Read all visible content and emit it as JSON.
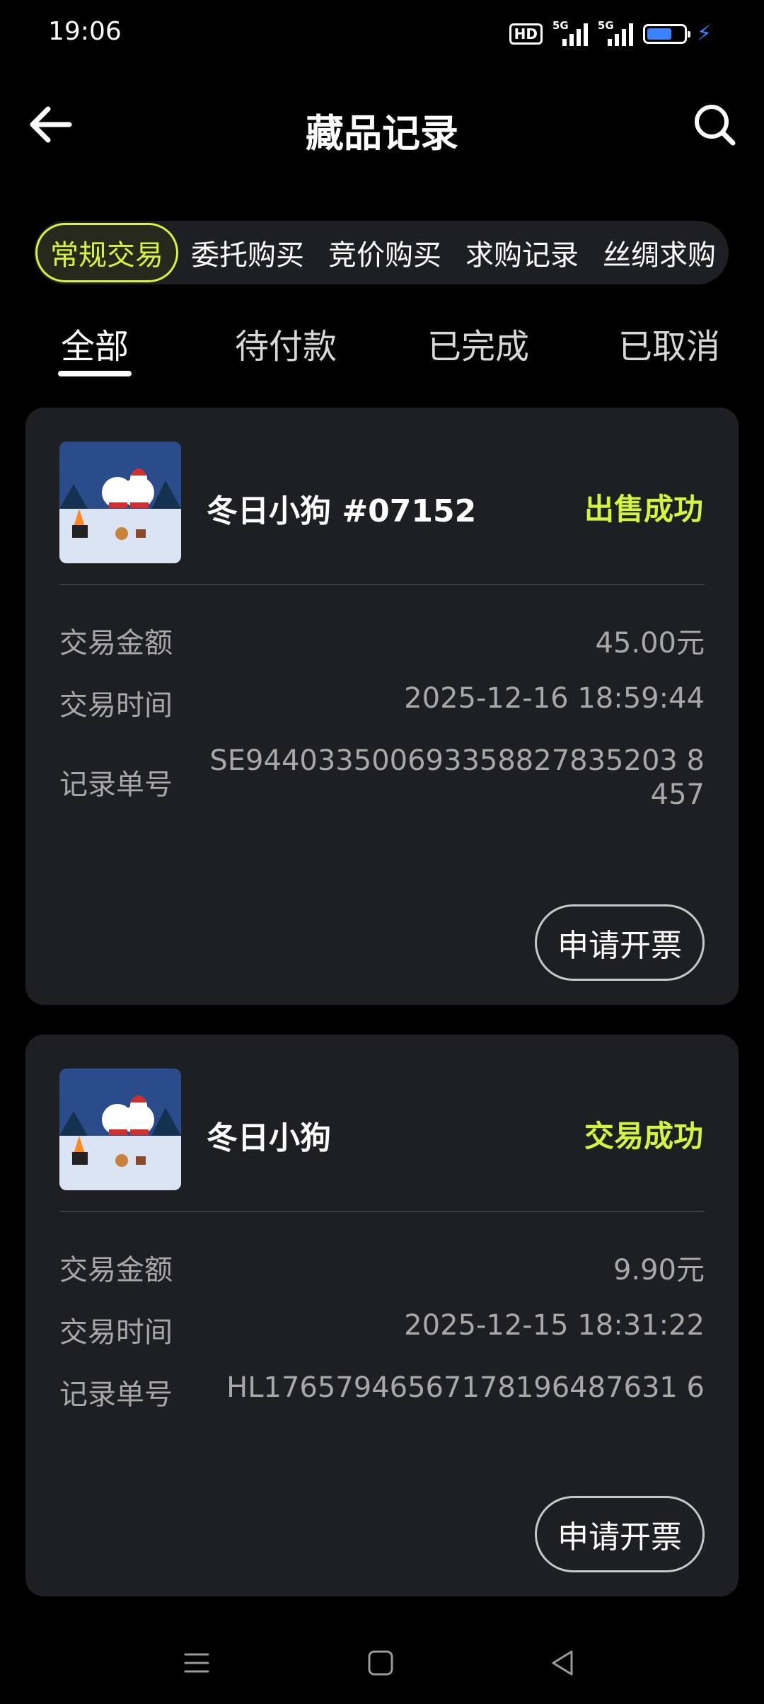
{
  "status_bar": {
    "time": "19:06",
    "hd_label": "HD",
    "net1": "5G",
    "net2": "5G"
  },
  "header": {
    "title": "藏品记录"
  },
  "categories": [
    "常规交易",
    "委托购买",
    "竞价购买",
    "求购记录",
    "丝绸求购"
  ],
  "tabs": [
    "全部",
    "待付款",
    "已完成",
    "已取消"
  ],
  "records": [
    {
      "name": "冬日小狗 #07152",
      "status": "出售成功",
      "amount_label": "交易金额",
      "amount": "45.00元",
      "time_label": "交易时间",
      "time": "2025-12-16 18:59:44",
      "id_label": "记录单号",
      "id_line1": "SE944033500693358827835203 8",
      "id_line2": "457",
      "button": "申请开票"
    },
    {
      "name": "冬日小狗",
      "status": "交易成功",
      "amount_label": "交易金额",
      "amount": "9.90元",
      "time_label": "交易时间",
      "time": "2025-12-15 18:31:22",
      "id_label": "记录单号",
      "id_line1": "HL17657946567178196487631 6",
      "button": "申请开票"
    }
  ],
  "icons": {
    "back": "arrow-left-icon",
    "search": "search-icon",
    "thumbnail": "winter-dogs-artwork",
    "nav_menu": "menu-icon",
    "nav_home": "square-icon",
    "nav_back": "triangle-back-icon"
  },
  "colors": {
    "background": "#000000",
    "card": "#1e1f22",
    "accent": "#d4f53c",
    "text_secondary": "#a8a8a8"
  }
}
